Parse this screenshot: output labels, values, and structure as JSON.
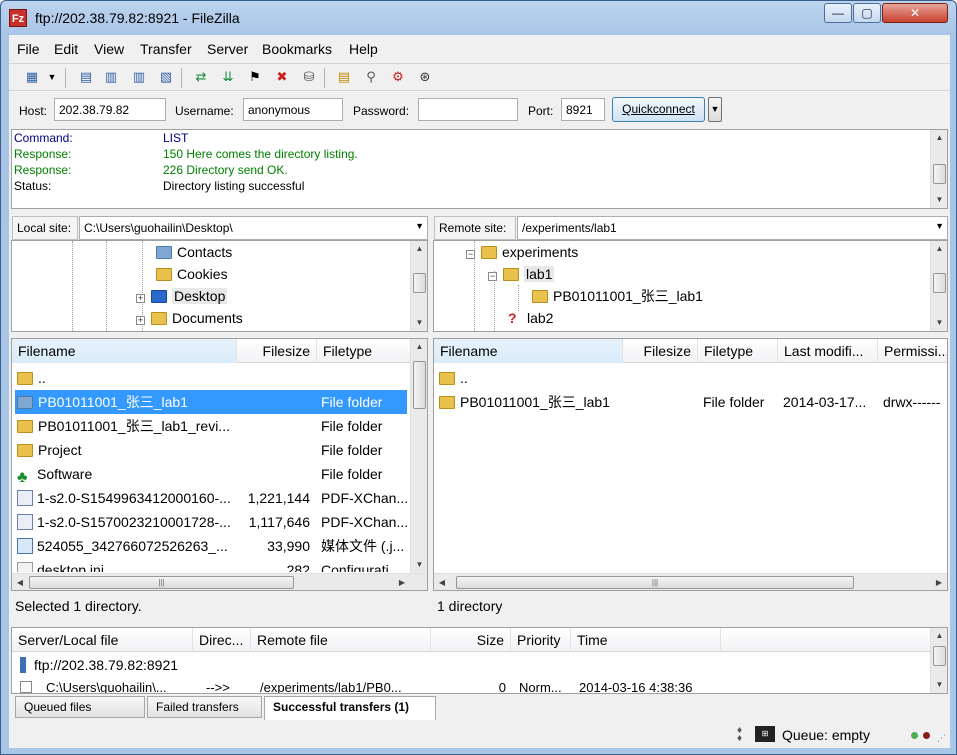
{
  "window": {
    "title": "ftp://202.38.79.82:8921 - FileZilla",
    "app_icon_text": "Fz",
    "controls": {
      "minimize": "—",
      "maximize": "▢",
      "close": "✕"
    }
  },
  "menu": [
    "File",
    "Edit",
    "View",
    "Transfer",
    "Server",
    "Bookmarks",
    "Help"
  ],
  "quickconnect": {
    "host_label": "Host:",
    "host_value": "202.38.79.82",
    "username_label": "Username:",
    "username_value": "anonymous",
    "password_label": "Password:",
    "password_value": "",
    "port_label": "Port:",
    "port_value": "8921",
    "button": "Quickconnect"
  },
  "log": [
    {
      "kind": "Command:",
      "text": "LIST",
      "color": "#000080"
    },
    {
      "kind": "Response:",
      "text": "150 Here comes the directory listing.",
      "color": "#008000"
    },
    {
      "kind": "Response:",
      "text": "226 Directory send OK.",
      "color": "#008000"
    },
    {
      "kind": "Status:",
      "text": "Directory listing successful",
      "color": "#000000"
    }
  ],
  "local": {
    "site_label": "Local site:",
    "site_path": "C:\\Users\\guohailin\\Desktop\\",
    "tree": [
      "Contacts",
      "Cookies",
      "Desktop",
      "Documents"
    ],
    "headers": [
      "Filename",
      "Filesize",
      "Filetype"
    ],
    "files": [
      {
        "name": "..",
        "size": "",
        "type": ""
      },
      {
        "name": "PB01011001_张三_lab1",
        "size": "",
        "type": "File folder"
      },
      {
        "name": "PB01011001_张三_lab1_revi...",
        "size": "",
        "type": "File folder"
      },
      {
        "name": "Project",
        "size": "",
        "type": "File folder"
      },
      {
        "name": "Software",
        "size": "",
        "type": "File folder"
      },
      {
        "name": "1-s2.0-S1549963412000160-...",
        "size": "1,221,144",
        "type": "PDF-XChan..."
      },
      {
        "name": "1-s2.0-S1570023210001728-...",
        "size": "1,117,646",
        "type": "PDF-XChan..."
      },
      {
        "name": "524055_342766072526263_...",
        "size": "33,990",
        "type": "媒体文件 (.j..."
      },
      {
        "name": "desktop.ini",
        "size": "282",
        "type": "Configurati..."
      }
    ],
    "status": "Selected 1 directory."
  },
  "remote": {
    "site_label": "Remote site:",
    "site_path": "/experiments/lab1",
    "tree": [
      "experiments",
      "lab1",
      "PB01011001_张三_lab1",
      "lab2"
    ],
    "headers": [
      "Filename",
      "Filesize",
      "Filetype",
      "Last modifi...",
      "Permissi..."
    ],
    "files": [
      {
        "name": "..",
        "size": "",
        "type": "",
        "modified": "",
        "perms": ""
      },
      {
        "name": "PB01011001_张三_lab1",
        "size": "",
        "type": "File folder",
        "modified": "2014-03-17...",
        "perms": "drwx------"
      }
    ],
    "status": "1 directory"
  },
  "queue": {
    "headers": [
      "Server/Local file",
      "Direc...",
      "Remote file",
      "Size",
      "Priority",
      "Time"
    ],
    "server": "ftp://202.38.79.82:8921",
    "row": {
      "local": "C:\\Users\\guohailin\\...",
      "dir": "-->>",
      "remote": "/experiments/lab1/PB0...",
      "size": "0",
      "priority": "Norm...",
      "time": "2014-03-16 4:38:36"
    }
  },
  "tabs": [
    "Queued files",
    "Failed transfers",
    "Successful transfers (1)"
  ],
  "statusbar": {
    "queue": "Queue: empty"
  }
}
